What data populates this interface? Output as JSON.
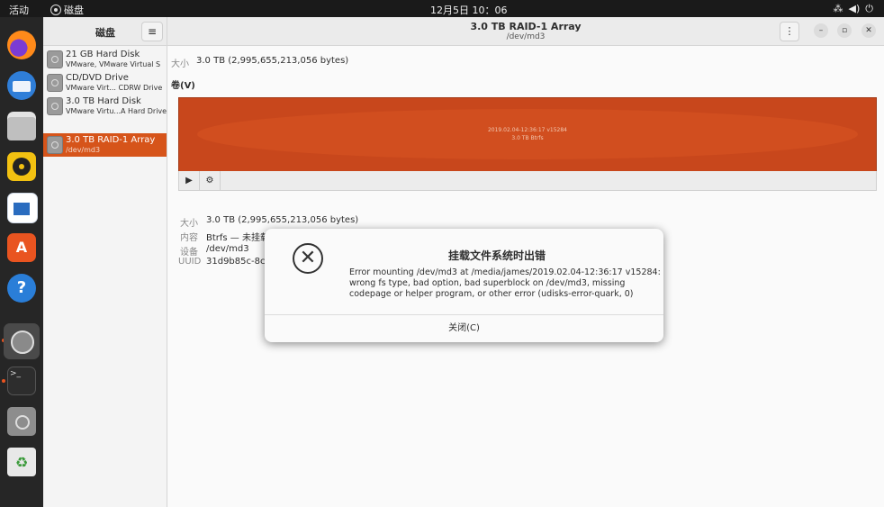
{
  "topbar": {
    "activities": "活动",
    "app_name": "磁盘",
    "clock": "12月5日  10：06",
    "tray_icons": [
      "network-icon",
      "volume-icon",
      "power-icon"
    ]
  },
  "sidebar": {
    "title": "磁盘",
    "disks": [
      {
        "name": "21 GB Hard Disk",
        "sub": "VMware, VMware Virtual S",
        "selected": false
      },
      {
        "name": "CD/DVD Drive",
        "sub": "VMware Virt...   CDRW Drive",
        "selected": false
      },
      {
        "name": "3.0 TB Hard Disk",
        "sub": "VMware Virtu...A Hard Drive",
        "selected": false
      },
      {
        "name": "3.0 TB RAID-1 Array",
        "sub": "/dev/md3",
        "selected": true
      }
    ]
  },
  "header": {
    "title": "3.0 TB RAID-1 Array",
    "subtitle": "/dev/md3",
    "menu_glyph": "⋮",
    "minimize_glyph": "–",
    "maximize_glyph": "▫",
    "close_glyph": "✕"
  },
  "content": {
    "size_label": "大小",
    "size_value": "3.0 TB (2,995,655,213,056 bytes)",
    "volumes_title": "卷(V)",
    "volume_block": {
      "line1": "2019.02.04-12:36:17 v15284",
      "line2": "3.0 TB Btrfs"
    },
    "details": [
      {
        "label": "大小",
        "value": "3.0 TB (2,995,655,213,056 bytes)"
      },
      {
        "label": "内容",
        "value": "Btrfs — 未挂载"
      },
      {
        "label": "设备",
        "value": "/dev/md3"
      },
      {
        "label": "UUID",
        "value": "31d9b85c-8ce"
      }
    ]
  },
  "dialog": {
    "title": "挂载文件系统时出错",
    "message_lines": [
      "Error mounting /dev/md3 at /media/james/2019.02.04-12:36:17 v15284:",
      "wrong fs type, bad option, bad superblock on /dev/md3, missing",
      "codepage or helper program, or other error (udisks-error-quark, 0)"
    ],
    "close_label": "关闭(C)"
  },
  "dock": {
    "apps": [
      "firefox-icon",
      "thunderbird-icon",
      "files-icon",
      "rhythmbox-icon",
      "writer-icon",
      "app-center-icon",
      "help-icon",
      "disks-icon",
      "terminal-icon",
      "disk-image-icon",
      "trash-icon"
    ]
  },
  "colors": {
    "accent": "#d6541a",
    "volume": "#c8471c",
    "dock": "#262626",
    "topbar": "#1a1a1a"
  }
}
